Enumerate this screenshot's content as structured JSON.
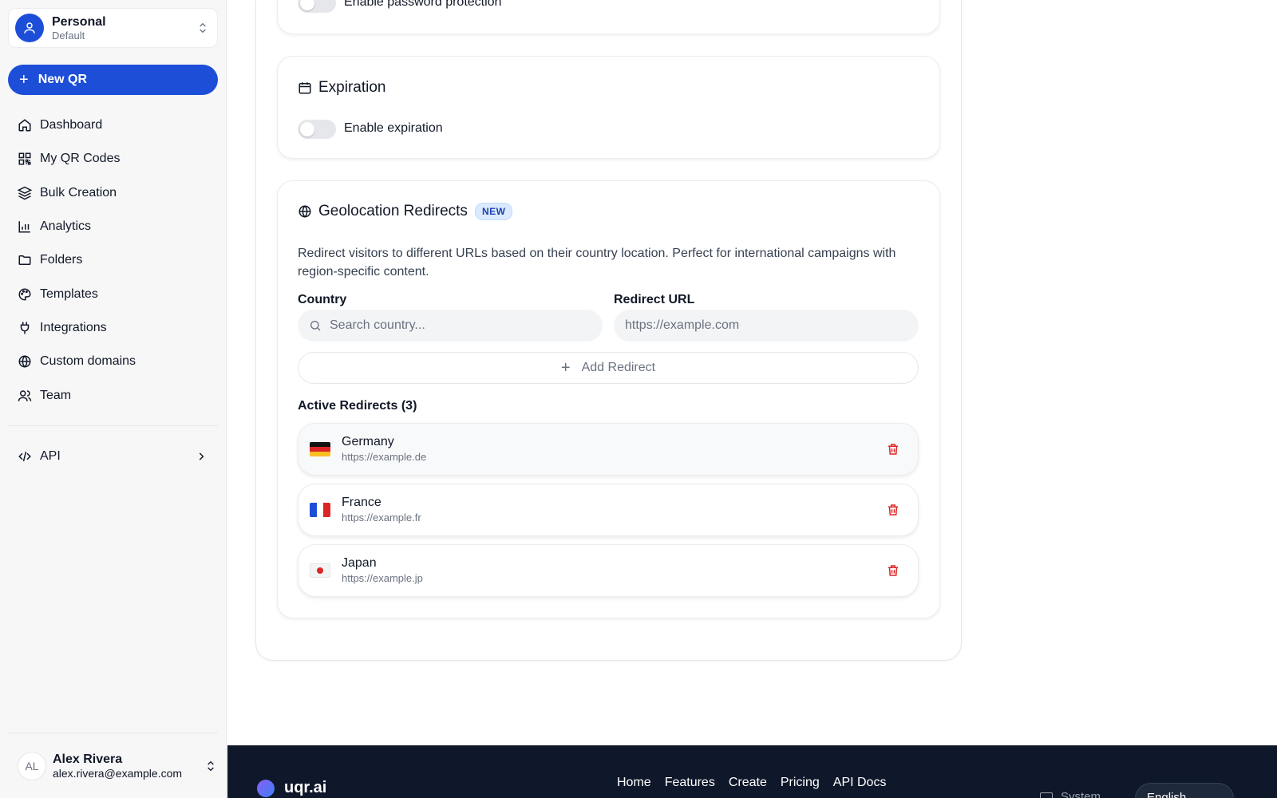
{
  "workspace": {
    "name": "Personal",
    "subtitle": "Default"
  },
  "new_qr_label": "New QR",
  "nav": [
    {
      "label": "Dashboard",
      "icon": "home-icon"
    },
    {
      "label": "My QR Codes",
      "icon": "qr-icon"
    },
    {
      "label": "Bulk Creation",
      "icon": "layers-icon"
    },
    {
      "label": "Analytics",
      "icon": "bar-chart-icon"
    },
    {
      "label": "Folders",
      "icon": "folder-icon"
    },
    {
      "label": "Templates",
      "icon": "palette-icon"
    },
    {
      "label": "Integrations",
      "icon": "plug-icon"
    },
    {
      "label": "Custom domains",
      "icon": "globe-icon"
    },
    {
      "label": "Team",
      "icon": "users-icon"
    }
  ],
  "api_label": "API",
  "user": {
    "initials": "AL",
    "name": "Alex Rivera",
    "email": "alex.rivera@example.com"
  },
  "password": {
    "toggle_label": "Enable password protection"
  },
  "expiration": {
    "title": "Expiration",
    "toggle_label": "Enable expiration"
  },
  "geo": {
    "title": "Geolocation Redirects",
    "badge": "NEW",
    "description": "Redirect visitors to different URLs based on their country location. Perfect for international campaigns with region-specific content.",
    "country_label": "Country",
    "country_placeholder": "Search country...",
    "url_label": "Redirect URL",
    "url_placeholder": "https://example.com",
    "add_label": "Add Redirect",
    "active_title": "Active Redirects (3)",
    "redirects": [
      {
        "country": "Germany",
        "url": "https://example.de"
      },
      {
        "country": "France",
        "url": "https://example.fr"
      },
      {
        "country": "Japan",
        "url": "https://example.jp"
      }
    ]
  },
  "footer": {
    "brand": "uqr.ai",
    "links": [
      "Home",
      "Features",
      "Create",
      "Pricing",
      "API Docs"
    ],
    "theme": "System",
    "language": "English"
  },
  "colors": {
    "primary": "#1d4ed8",
    "danger": "#dc2626",
    "footer_bg": "#0f172a"
  }
}
